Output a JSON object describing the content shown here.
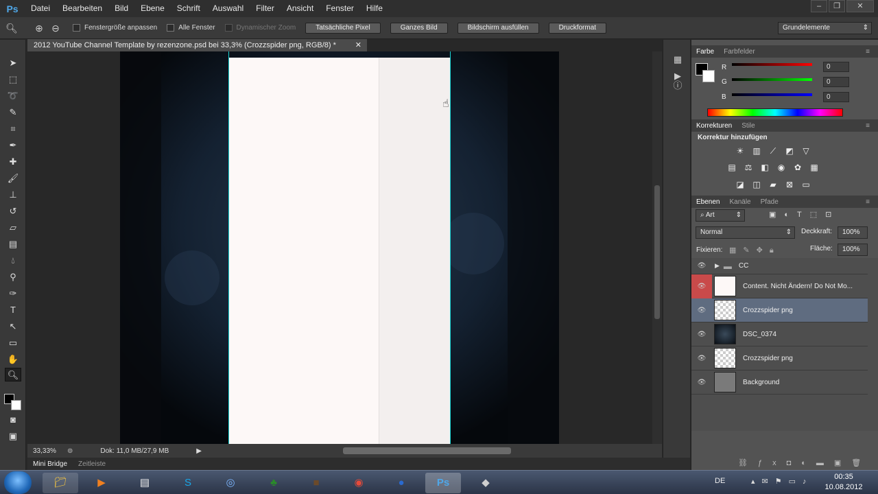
{
  "app": {
    "logo": "Ps"
  },
  "menu": [
    "Datei",
    "Bearbeiten",
    "Bild",
    "Ebene",
    "Schrift",
    "Auswahl",
    "Filter",
    "Ansicht",
    "Fenster",
    "Hilfe"
  ],
  "options": {
    "fit_window": "Fenstergröße anpassen",
    "all_windows": "Alle Fenster",
    "dynamic_zoom": "Dynamischer Zoom",
    "actual_pixels": "Tatsächliche Pixel",
    "whole_image": "Ganzes Bild",
    "fill_screen": "Bildschirm ausfüllen",
    "print_size": "Druckformat",
    "workspace": "Grundelemente"
  },
  "document": {
    "tab_title": "2012 YouTube Channel Template by rezenzone.psd bei 33,3% (Crozzspider png, RGB/8) *",
    "zoom": "33,33%",
    "doc_size": "Dok: 11,0 MB/27,9 MB"
  },
  "bottom_tabs": {
    "mini_bridge": "Mini Bridge",
    "timeline": "Zeitleiste"
  },
  "color_panel": {
    "tabs": [
      "Farbe",
      "Farbfelder"
    ],
    "channels": [
      {
        "label": "R",
        "value": "0"
      },
      {
        "label": "G",
        "value": "0"
      },
      {
        "label": "B",
        "value": "0"
      }
    ]
  },
  "adjust_panel": {
    "tabs": [
      "Korrekturen",
      "Stile"
    ],
    "heading": "Korrektur hinzufügen"
  },
  "layers_panel": {
    "tabs": [
      "Ebenen",
      "Kanäle",
      "Pfade"
    ],
    "filter": "Art",
    "blend_mode": "Normal",
    "opacity_label": "Deckkraft:",
    "opacity": "100%",
    "lock_label": "Fixieren:",
    "fill_label": "Fläche:",
    "fill": "100%",
    "layers": [
      {
        "name": "CC",
        "type": "group"
      },
      {
        "name": "Content. Nicht Ändern! Do Not Mo...",
        "type": "white"
      },
      {
        "name": "Crozzspider png",
        "type": "smart",
        "selected": true
      },
      {
        "name": "DSC_0374",
        "type": "photo"
      },
      {
        "name": "Crozzspider png",
        "type": "smart"
      },
      {
        "name": "Background",
        "type": "gray"
      }
    ]
  },
  "taskbar": {
    "lang": "DE",
    "time": "00:35",
    "date": "10.08.2012"
  }
}
